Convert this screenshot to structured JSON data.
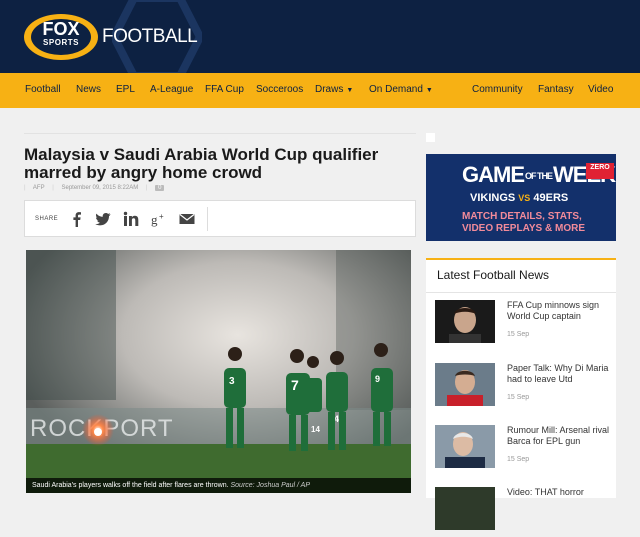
{
  "header": {
    "brand": "FOOTBALL",
    "logo_text": "FOX",
    "logo_subtext": "SPORTS"
  },
  "nav": {
    "items": [
      {
        "label": "Football",
        "dropdown": false
      },
      {
        "label": "News",
        "dropdown": false
      },
      {
        "label": "EPL",
        "dropdown": false
      },
      {
        "label": "A-League",
        "dropdown": false
      },
      {
        "label": "FFA Cup",
        "dropdown": false
      },
      {
        "label": "Socceroos",
        "dropdown": false
      },
      {
        "label": "Draws",
        "dropdown": true
      },
      {
        "label": "On Demand",
        "dropdown": true
      },
      {
        "label": "Community",
        "dropdown": false
      },
      {
        "label": "Fantasy",
        "dropdown": false
      },
      {
        "label": "Video",
        "dropdown": false
      }
    ]
  },
  "article": {
    "headline": "Malaysia v Saudi Arabia World Cup qualifier marred by angry home crowd",
    "author": "AFP",
    "date": "September 09, 2015 8:22AM",
    "comments": "0",
    "share_label": "SHARE",
    "caption": "Saudi Arabia's players walks off the field after flares are thrown.",
    "caption_source": "Source: Joshua Paul / AP",
    "banner_text": "ROCKPORT"
  },
  "ad": {
    "title_left": "GAME",
    "title_of": "OF THE",
    "title_right": "WEEK",
    "badge": "ZERO",
    "team1": "VIKINGS",
    "vs": "VS",
    "team2": "49ERS",
    "line1": "MATCH DETAILS, STATS,",
    "line2": "VIDEO REPLAYS & MORE"
  },
  "sidebar": {
    "title": "Latest Football News",
    "items": [
      {
        "title": "FFA Cup minnows sign World Cup captain",
        "date": "15 Sep"
      },
      {
        "title": "Paper Talk: Why Di Maria had to leave Utd",
        "date": "15 Sep"
      },
      {
        "title": "Rumour Mill: Arsenal rival Barca for EPL gun",
        "date": "15 Sep"
      },
      {
        "title": "Video: THAT horror",
        "date": ""
      }
    ]
  },
  "colors": {
    "navy": "#0d2142",
    "accent": "#f7b114",
    "ad_bg": "#13306b"
  }
}
